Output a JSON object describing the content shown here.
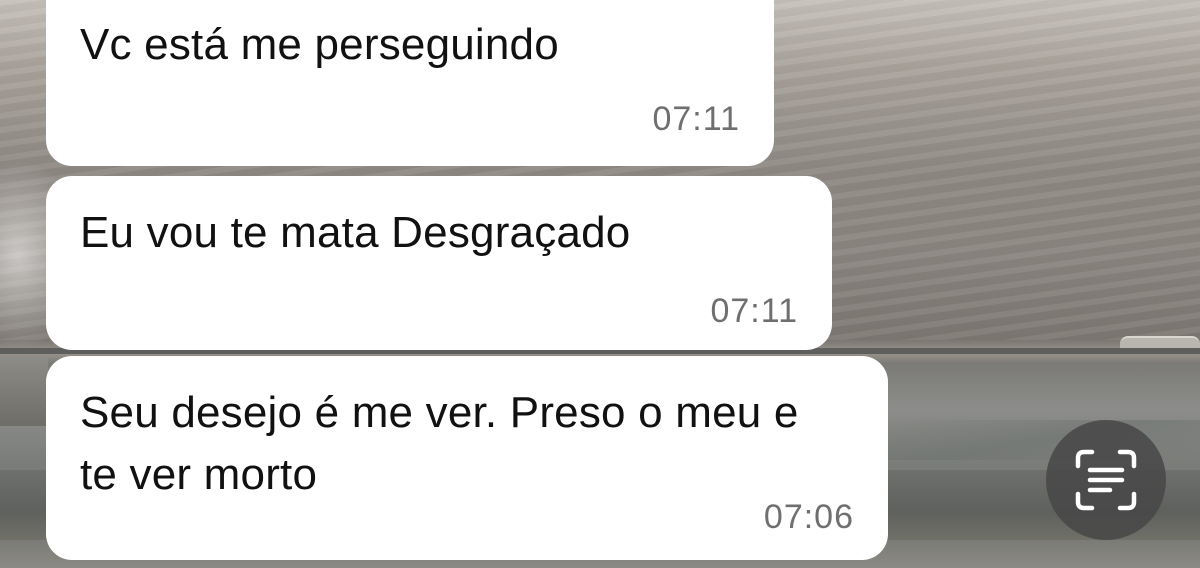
{
  "messages": [
    {
      "text": "Vc está me perseguindo",
      "time": "07:11"
    },
    {
      "text": "Eu vou te mata Desgraçado",
      "time": "07:11"
    },
    {
      "text": "Seu desejo é me ver. Preso o meu e te ver morto",
      "time": "07:06"
    }
  ],
  "scan_button": {
    "icon": "text-scan-icon"
  }
}
